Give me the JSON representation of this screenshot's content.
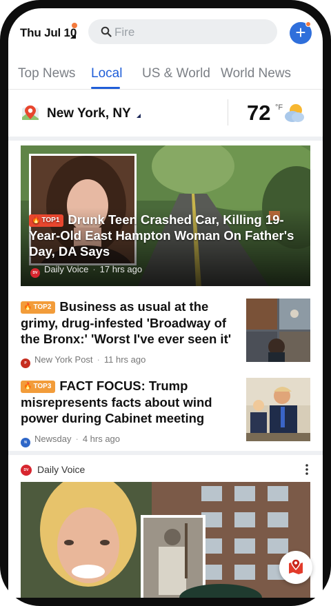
{
  "header": {
    "date": "Thu Jul 10",
    "search_placeholder": "Fire"
  },
  "tabs": [
    {
      "label": "Top News",
      "active": false
    },
    {
      "label": "Local",
      "active": true
    },
    {
      "label": "US & World",
      "active": false
    },
    {
      "label": "World News",
      "active": false
    }
  ],
  "location": {
    "city": "New York, NY",
    "temperature": "72",
    "unit": "°F",
    "weather_icon": "partly-cloudy-icon"
  },
  "stories": [
    {
      "badge": "TOP1",
      "title": "Drunk Teen Crashed Car, Killing 19-Year-Old East Hampton Woman On Father's Day, DA Says",
      "source": "Daily Voice",
      "time": "17 hrs ago"
    },
    {
      "badge": "TOP2",
      "title": "Business as usual at the grimy, drug-infested 'Broadway of the Bronx:' 'Worst I've ever seen it'",
      "source": "New York Post",
      "time": "11 hrs ago"
    },
    {
      "badge": "TOP3",
      "title": "FACT FOCUS: Trump misrepresents facts about wind power during Cabinet meeting",
      "source": "Newsday",
      "time": "4 hrs ago"
    }
  ],
  "card": {
    "source": "Daily Voice"
  },
  "colors": {
    "accent": "#1f5ed8",
    "badge_top1": "#e8462e",
    "badge_other": "#f29c3a",
    "notification": "#f37a3d"
  }
}
